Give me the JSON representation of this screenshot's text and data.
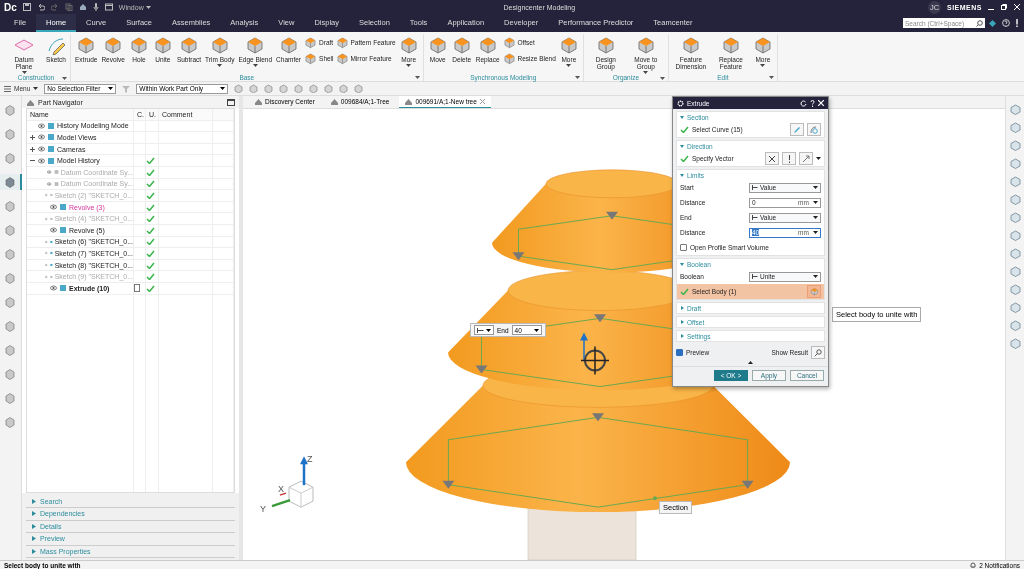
{
  "title_bar": {
    "logo": "Dc",
    "window_menu": "Window",
    "title": "Designcenter Modeling",
    "user_initials": "JC",
    "brand": "SIEMENS"
  },
  "menu_tabs": [
    {
      "label": "File",
      "selected": false
    },
    {
      "label": "Home",
      "selected": true
    },
    {
      "label": "Curve",
      "selected": false
    },
    {
      "label": "Surface",
      "selected": false
    },
    {
      "label": "Assemblies",
      "selected": false
    },
    {
      "label": "Analysis",
      "selected": false
    },
    {
      "label": "View",
      "selected": false
    },
    {
      "label": "Display",
      "selected": false
    },
    {
      "label": "Selection",
      "selected": false
    },
    {
      "label": "Tools",
      "selected": false
    },
    {
      "label": "Application",
      "selected": false
    },
    {
      "label": "Developer",
      "selected": false
    },
    {
      "label": "Performance Predictor",
      "selected": false
    },
    {
      "label": "Teamcenter",
      "selected": false
    }
  ],
  "search": {
    "placeholder": "Search (Ctrl+Space)"
  },
  "ribbon": {
    "groups": [
      {
        "label": "Construction",
        "items": [
          {
            "label": "Datum Plane",
            "kind": "large",
            "dropdown": true
          },
          {
            "label": "Sketch",
            "kind": "large",
            "dropdown": false
          }
        ]
      },
      {
        "label": "Base",
        "items": [
          {
            "label": "Extrude",
            "kind": "large",
            "dropdown": false
          },
          {
            "label": "Revolve",
            "kind": "large",
            "dropdown": false
          },
          {
            "label": "Hole",
            "kind": "large",
            "dropdown": false
          },
          {
            "label": "Unite",
            "kind": "large",
            "dropdown": false
          },
          {
            "label": "Subtract",
            "kind": "large",
            "dropdown": false
          },
          {
            "label": "Trim Body",
            "kind": "large",
            "dropdown": true
          },
          {
            "label": "Edge Blend",
            "kind": "large",
            "dropdown": true
          },
          {
            "label": "Chamfer",
            "kind": "large",
            "dropdown": false
          },
          {
            "label": "Draft",
            "kind": "small",
            "dropdown": false
          },
          {
            "label": "Shell",
            "kind": "small",
            "dropdown": false
          },
          {
            "label": "Pattern Feature",
            "kind": "small",
            "dropdown": false
          },
          {
            "label": "Mirror Feature",
            "kind": "small",
            "dropdown": false
          },
          {
            "label": "More",
            "kind": "large",
            "dropdown": true
          }
        ]
      },
      {
        "label": "Synchronous Modeling",
        "items": [
          {
            "label": "Move",
            "kind": "large",
            "dropdown": false
          },
          {
            "label": "Delete",
            "kind": "large",
            "dropdown": false
          },
          {
            "label": "Replace",
            "kind": "large",
            "dropdown": false
          },
          {
            "label": "Offset",
            "kind": "small",
            "dropdown": false
          },
          {
            "label": "Resize Blend",
            "kind": "small",
            "dropdown": false
          },
          {
            "label": "More",
            "kind": "large",
            "dropdown": true
          }
        ]
      },
      {
        "label": "Organize",
        "items": [
          {
            "label": "Design Group",
            "kind": "large",
            "dropdown": false
          },
          {
            "label": "Move to Group",
            "kind": "large",
            "dropdown": true
          }
        ]
      },
      {
        "label": "Edit",
        "items": [
          {
            "label": "Feature Dimension",
            "kind": "large",
            "dropdown": false
          },
          {
            "label": "Replace Feature",
            "kind": "large",
            "dropdown": false
          },
          {
            "label": "More",
            "kind": "large",
            "dropdown": true
          }
        ]
      }
    ]
  },
  "toolbar": {
    "menu": "Menu",
    "selection_filter": "No Selection Filter",
    "scope": "Within Work Part Only"
  },
  "left_strip": [
    {
      "selected": false
    },
    {
      "selected": false
    },
    {
      "selected": false
    },
    {
      "selected": true
    },
    {
      "selected": false
    },
    {
      "selected": false
    },
    {
      "selected": false
    },
    {
      "selected": false
    },
    {
      "selected": false
    },
    {
      "selected": false
    },
    {
      "selected": false
    },
    {
      "selected": false
    },
    {
      "selected": false
    },
    {
      "selected": false
    }
  ],
  "navigator": {
    "title": "Part Navigator",
    "columns": [
      "Name",
      "C.",
      "U.",
      "Comment"
    ],
    "rows": [
      {
        "label": "History Modeling Mode",
        "suppressed": false,
        "highlighted": false,
        "current": false,
        "u": false
      },
      {
        "label": "Model Views",
        "suppressed": false,
        "highlighted": false,
        "current": false,
        "u": false,
        "expanded": false
      },
      {
        "label": "Cameras",
        "suppressed": false,
        "highlighted": false,
        "current": false,
        "u": false,
        "expanded": false
      },
      {
        "label": "Model History",
        "suppressed": false,
        "highlighted": false,
        "current": false,
        "u": true,
        "expanded": true,
        "children": [
          {
            "label": "Datum Coordinate Sy...",
            "suppressed": true,
            "highlighted": false,
            "current": false,
            "u": true
          },
          {
            "label": "Datum Coordinate Sy...",
            "suppressed": true,
            "highlighted": false,
            "current": false,
            "u": true
          },
          {
            "label": "Sketch (2) \"SKETCH_0...",
            "suppressed": true,
            "highlighted": false,
            "current": false,
            "u": true
          },
          {
            "label": "Revolve (3)",
            "suppressed": false,
            "highlighted": true,
            "current": false,
            "u": true
          },
          {
            "label": "Sketch (4) \"SKETCH_0...",
            "suppressed": true,
            "highlighted": false,
            "current": false,
            "u": true
          },
          {
            "label": "Revolve (5)",
            "suppressed": false,
            "highlighted": false,
            "current": false,
            "u": true
          },
          {
            "label": "Sketch (6) \"SKETCH_0...",
            "suppressed": false,
            "highlighted": false,
            "current": false,
            "u": true
          },
          {
            "label": "Sketch (7) \"SKETCH_0...",
            "suppressed": false,
            "highlighted": false,
            "current": false,
            "u": true
          },
          {
            "label": "Sketch (8) \"SKETCH_0...",
            "suppressed": false,
            "highlighted": false,
            "current": false,
            "u": true
          },
          {
            "label": "Sketch (9) \"SKETCH_0...",
            "suppressed": true,
            "highlighted": false,
            "current": false,
            "u": true
          },
          {
            "label": "Extrude (10)",
            "suppressed": false,
            "highlighted": false,
            "current": true,
            "u": true
          }
        ]
      }
    ],
    "panels": [
      {
        "label": "Search",
        "expanded": false
      },
      {
        "label": "Dependencies",
        "expanded": false
      },
      {
        "label": "Details",
        "expanded": false
      },
      {
        "label": "Preview",
        "expanded": false
      },
      {
        "label": "Mass Properties",
        "expanded": false
      }
    ]
  },
  "viewport": {
    "tabs": [
      {
        "label": "Discovery Center",
        "selected": false
      },
      {
        "label": "009684/A;1-Tree",
        "selected": false
      },
      {
        "label": "009691/A;1-New tree",
        "selected": true
      }
    ],
    "end_widget": {
      "label": "End",
      "value": "40"
    },
    "tooltip": "Select body to unite with",
    "section_label": "Section",
    "triad": {
      "x": "X",
      "y": "Y",
      "z": "Z"
    }
  },
  "dialog": {
    "title": "Extrude",
    "sections": [
      {
        "title": "Section",
        "expanded": true,
        "rows": [
          {
            "kind": "select",
            "label": "Select Curve (15)",
            "done": true,
            "active": false
          }
        ]
      },
      {
        "title": "Direction",
        "expanded": true,
        "rows": [
          {
            "kind": "vector",
            "label": "Specify Vector",
            "done": true,
            "active": false
          }
        ]
      },
      {
        "title": "Limits",
        "expanded": true,
        "rows": [
          {
            "kind": "dropdown",
            "label": "Start",
            "value": "Value"
          },
          {
            "kind": "number",
            "label": "Distance",
            "value": "0",
            "unit": "mm",
            "focused": false
          },
          {
            "kind": "dropdown",
            "label": "End",
            "value": "Value"
          },
          {
            "kind": "number",
            "label": "Distance",
            "value": "40",
            "unit": "mm",
            "focused": true
          },
          {
            "kind": "checkbox",
            "label": "Open Profile Smart Volume",
            "checked": false
          }
        ]
      },
      {
        "title": "Boolean",
        "expanded": true,
        "rows": [
          {
            "kind": "dropdown",
            "label": "Boolean",
            "value": "Unite"
          },
          {
            "kind": "body",
            "label": "Select Body (1)",
            "done": true,
            "active": true
          }
        ]
      },
      {
        "title": "Draft",
        "expanded": false
      },
      {
        "title": "Offset",
        "expanded": false
      },
      {
        "title": "Settings",
        "expanded": false
      }
    ],
    "preview": {
      "label": "Preview",
      "checked": true
    },
    "show_result": "Show Result",
    "buttons": [
      {
        "label": "< OK >",
        "default": true
      },
      {
        "label": "Apply",
        "default": false
      },
      {
        "label": "Cancel",
        "default": false
      }
    ]
  },
  "status_bar": {
    "prompt": "Select body to unite with",
    "notifications": "2 Notifications"
  }
}
